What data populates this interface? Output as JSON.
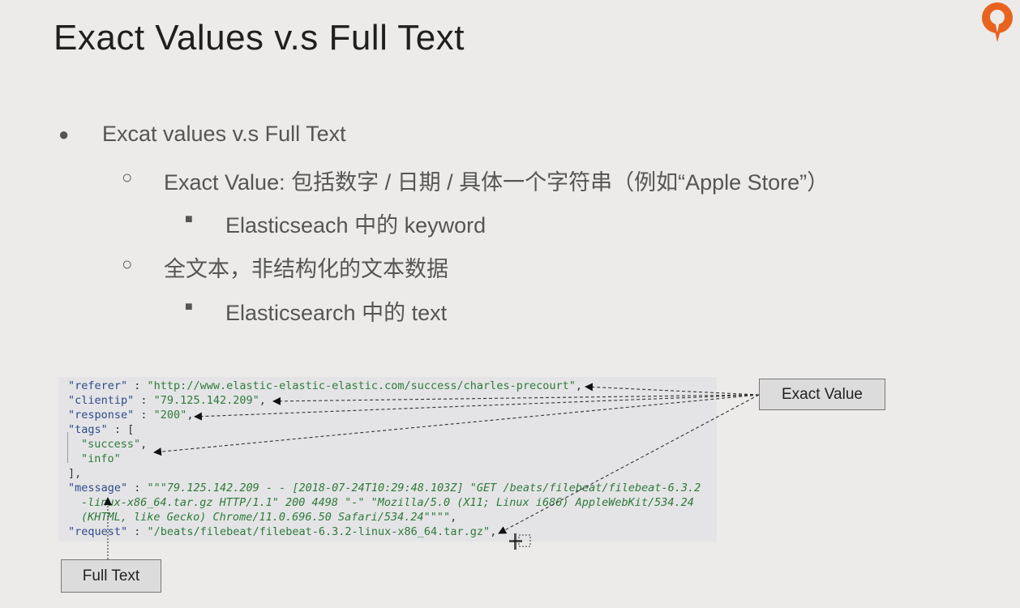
{
  "slide": {
    "title": "Exact Values v.s Full Text"
  },
  "bullets": {
    "level1": {
      "mark": "●",
      "text": "Excat values v.s Full Text"
    },
    "exact": {
      "mark": "○",
      "text": "Exact Value: 包括数字 / 日期 / 具体一个字符串（例如“Apple Store”）"
    },
    "exact_sub": {
      "mark": "■",
      "text": "Elasticseach 中的 keyword"
    },
    "fulltext": {
      "mark": "○",
      "text": "全文本，非结构化的文本数据"
    },
    "fulltext_sub": {
      "mark": "■",
      "text": "Elasticsearch 中的 text"
    }
  },
  "code": {
    "referer_key": "\"referer\"",
    "referer_val": "\"http://www.elastic-elastic-elastic.com/success/charles-precourt\"",
    "clientip_key": "\"clientip\"",
    "clientip_val": "\"79.125.142.209\"",
    "response_key": "\"response\"",
    "response_val": "\"200\"",
    "tags_key": "\"tags\"",
    "tags_open": "[",
    "tag_success": "\"success\"",
    "tag_info": "\"info\"",
    "tags_close": "],",
    "message_key": "\"message\"",
    "message_line1": "\"\"\"79.125.142.209 - - [2018-07-24T10:29:48.103Z] \"GET /beats/filebeat/filebeat-6.3.2",
    "message_line2": "-linux-x86_64.tar.gz HTTP/1.1\" 200 4498 \"-\" \"Mozilla/5.0 (X11; Linux i686) AppleWebKit/534.24",
    "message_line3": "(KHTML, like Gecko) Chrome/11.0.696.50 Safari/534.24\"\"\"\"",
    "request_key": "\"request\"",
    "request_val": "\"/beats/filebeat/filebeat-6.3.2-linux-x86_64.tar.gz\""
  },
  "labels": {
    "exact_value": "Exact Value",
    "full_text": "Full Text"
  },
  "colors": {
    "background": "#ecebe9",
    "code_panel": "#e4e4e6",
    "key": "#2e4a8a",
    "string": "#2e7a3a",
    "logo": "#e8641e"
  },
  "icons": {
    "logo": "orange-q-logo-icon"
  }
}
